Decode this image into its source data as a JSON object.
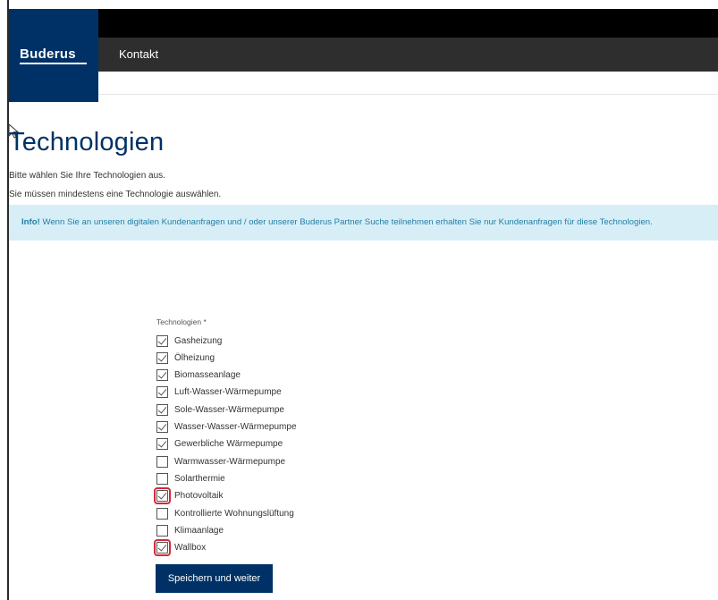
{
  "header": {
    "brand": "Buderus",
    "nav_link": "Kontakt"
  },
  "main": {
    "title": "Technologien",
    "subtitle_1": "Bitte wählen Sie Ihre Technologien aus.",
    "subtitle_2": "Sie müssen mindestens eine Technologie auswählen.",
    "info_label": "Info!",
    "info_text": " Wenn Sie an unseren digitalen Kundenanfragen und / oder unserer Buderus Partner Suche teilnehmen erhalten Sie nur Kundenanfragen für diese Technologien."
  },
  "form": {
    "field_label": "Technologien *",
    "options": [
      {
        "label": "Gasheizung",
        "checked": true,
        "highlighted": false
      },
      {
        "label": "Ölheizung",
        "checked": true,
        "highlighted": false
      },
      {
        "label": "Biomasseanlage",
        "checked": true,
        "highlighted": false
      },
      {
        "label": "Luft-Wasser-Wärmepumpe",
        "checked": true,
        "highlighted": false
      },
      {
        "label": "Sole-Wasser-Wärmepumpe",
        "checked": true,
        "highlighted": false
      },
      {
        "label": "Wasser-Wasser-Wärmepumpe",
        "checked": true,
        "highlighted": false
      },
      {
        "label": "Gewerbliche Wärmepumpe",
        "checked": true,
        "highlighted": false
      },
      {
        "label": "Warmwasser-Wärmepumpe",
        "checked": false,
        "highlighted": false
      },
      {
        "label": "Solarthermie",
        "checked": false,
        "highlighted": false
      },
      {
        "label": "Photovoltaik",
        "checked": true,
        "highlighted": true
      },
      {
        "label": "Kontrollierte Wohnungslüftung",
        "checked": false,
        "highlighted": false
      },
      {
        "label": "Klimaanlage",
        "checked": false,
        "highlighted": false
      },
      {
        "label": "Wallbox",
        "checked": true,
        "highlighted": true
      }
    ],
    "submit_label": "Speichern und weiter"
  },
  "colors": {
    "brand_blue": "#003166",
    "info_bg": "#d8eef7",
    "info_text": "#1f7fa5",
    "highlight_red": "#d6293a"
  }
}
